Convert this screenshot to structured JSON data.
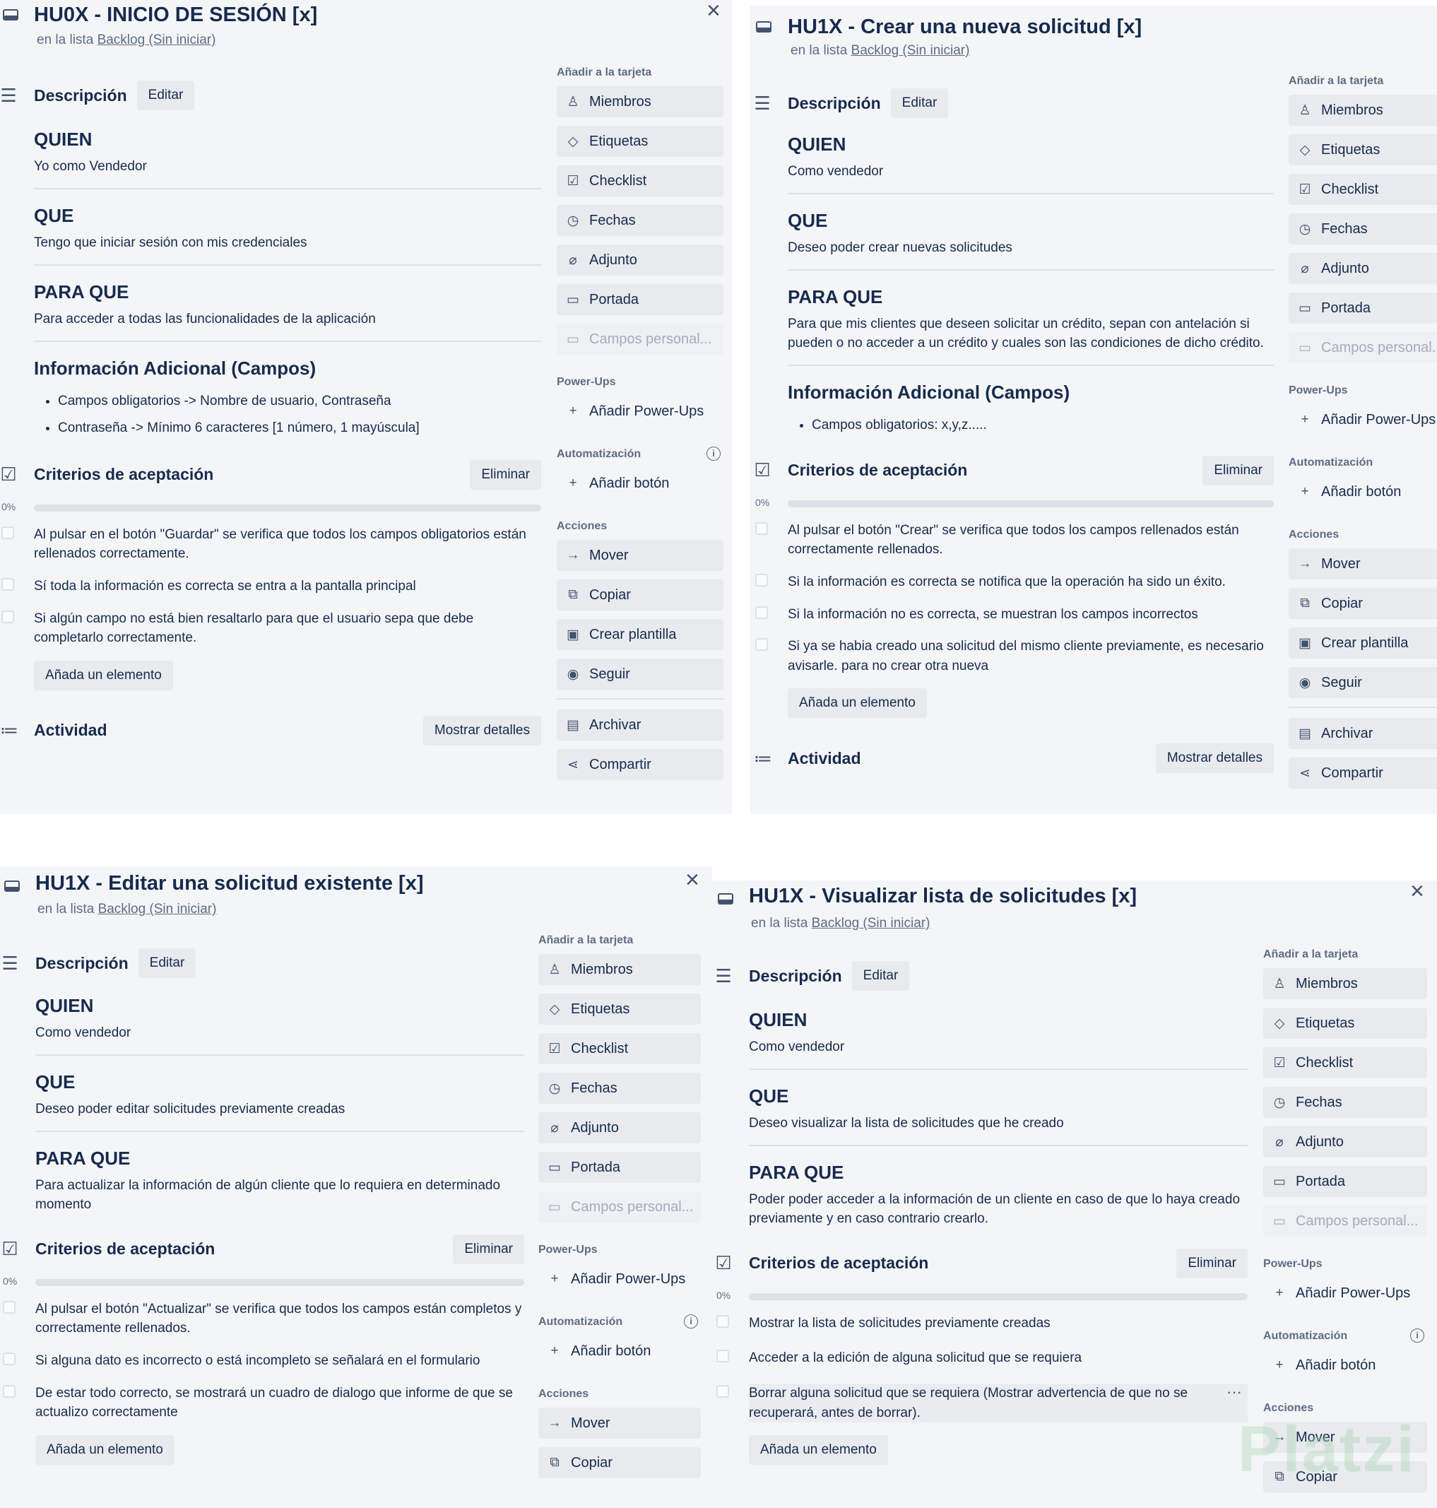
{
  "common": {
    "list_prefix": "en la lista",
    "list_name": "Backlog (Sin iniciar)",
    "description_label": "Descripción",
    "edit_label": "Editar",
    "quien": "QUIEN",
    "que": "QUE",
    "para_que": "PARA QUE",
    "info_heading": "Información Adicional (Campos)",
    "criteria_label": "Criterios de aceptación",
    "delete_label": "Eliminar",
    "progress_pct": "0%",
    "progress_value": 0,
    "add_item_label": "Añada un elemento",
    "activity_label": "Actividad",
    "details_label": "Mostrar detalles",
    "close_glyph": "×",
    "sidebar": {
      "add_to_card": "Añadir a la tarjeta",
      "members": "Miembros",
      "labels": "Etiquetas",
      "checklist": "Checklist",
      "dates": "Fechas",
      "attachment": "Adjunto",
      "cover": "Portada",
      "custom_fields": "Campos personal...",
      "powerups": "Power-Ups",
      "add_powerups": "Añadir Power-Ups",
      "automation": "Automatización",
      "add_button": "Añadir botón",
      "actions": "Acciones",
      "move": "Mover",
      "copy": "Copiar",
      "template": "Crear plantilla",
      "follow": "Seguir",
      "archive": "Archivar",
      "share": "Compartir",
      "info_glyph": "i"
    }
  },
  "cards": [
    {
      "title": "HU0X - INICIO DE SESIÓN [x]",
      "quien_text": "Yo como Vendedor",
      "que_text": "Tengo que iniciar sesión con mis credenciales",
      "para_que_text": "Para acceder a todas las funcionalidades de la aplicación",
      "info_items": [
        "Campos obligatorios -> Nombre de usuario, Contraseña",
        "Contraseña -> Mínimo 6 caracteres [1 número, 1 mayúscula]"
      ],
      "criteria": [
        "Al pulsar en el botón \"Guardar\" se verifica que todos los campos obligatorios están rellenados correctamente.",
        "Sí toda la información es correcta se entra a la pantalla principal",
        "Si algún campo no está bien resaltarlo para que el usuario sepa que debe completarlo correctamente."
      ]
    },
    {
      "title": "HU1X - Crear una nueva solicitud [x]",
      "quien_text": "Como vendedor",
      "que_text": "Deseo poder crear nuevas solicitudes",
      "para_que_text": "Para que mis clientes que deseen solicitar un crédito, sepan con antelación si pueden o no acceder a un crédito y cuales son las condiciones de dicho crédito.",
      "info_items": [
        "Campos obligatorios: x,y,z....."
      ],
      "criteria": [
        "Al pulsar el botón \"Crear\" se verifica que todos los campos rellenados están correctamente rellenados.",
        "Si la información es correcta se notifica que la operación ha sido un éxito.",
        "Si la información no es correcta, se muestran los campos incorrectos",
        "Si ya se habia creado una solicitud del mismo cliente previamente, es necesario avisarle. para no crear otra nueva"
      ]
    },
    {
      "title": "HU1X - Editar una solicitud existente [x]",
      "quien_text": "Como vendedor",
      "que_text": "Deseo poder editar solicitudes previamente creadas",
      "para_que_text": "Para actualizar la información de algún cliente que lo requiera en determinado momento",
      "criteria": [
        "Al pulsar el botón \"Actualizar\" se verifica que todos los campos están completos y correctamente rellenados.",
        "Si alguna dato es incorrecto o está incompleto se señalará en el formulario",
        "De estar todo correcto, se mostrará un cuadro de dialogo que informe de que se actualizo correctamente"
      ]
    },
    {
      "title": "HU1X - Visualizar lista de solicitudes [x]",
      "quien_text": "Como vendedor",
      "que_text": "Deseo visualizar la lista de solicitudes que he creado",
      "para_que_text": "Poder poder acceder a la información de un cliente en caso de que lo haya creado previamente y en caso contrario crearlo.",
      "criteria": [
        "Mostrar la lista de solicitudes previamente creadas",
        "Acceder a la edición de alguna solicitud que se requiera",
        "Borrar alguna solicitud que se requiera (Mostrar advertencia de que no se recuperará, antes de borrar)."
      ],
      "item_menu_glyph": "···",
      "watermark": "Platzi"
    }
  ]
}
